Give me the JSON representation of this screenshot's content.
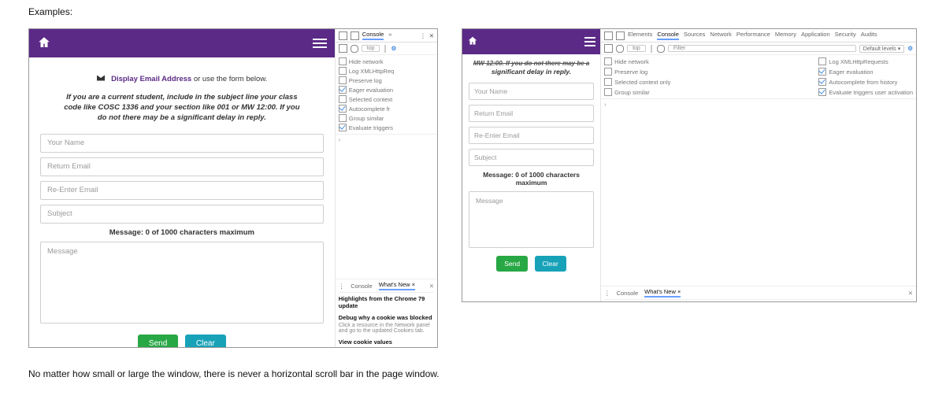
{
  "heading": "Examples:",
  "footnote": "No matter how small or large the window, there is never a horizontal scroll bar in the page window.",
  "ex1": {
    "form": {
      "cta_link": "Display Email Address",
      "cta_rest": " or use the form below.",
      "instructions": "If you are a current student, include in the subject line your class code like COSC 1336 and your section like 001 or MW 12:00. If you do not there may be a significant delay in reply.",
      "fields": [
        "Your Name",
        "Return Email",
        "Re-Enter Email",
        "Subject"
      ],
      "message_counter": "Message: 0 of 1000 characters maximum",
      "message_placeholder": "Message",
      "buttons": {
        "send": "Send",
        "clear": "Clear"
      }
    },
    "dev": {
      "tabs": [
        "Console",
        "»"
      ],
      "context": "top",
      "opts": [
        {
          "label": "Hide network",
          "checked": false
        },
        {
          "label": "Log XMLHttpReq",
          "checked": false
        },
        {
          "label": "Preserve log",
          "checked": false
        },
        {
          "label": "Eager evaluation",
          "checked": true
        },
        {
          "label": "Selected context",
          "checked": false
        },
        {
          "label": "Autocomplete fr",
          "checked": true
        },
        {
          "label": "Group similar",
          "checked": false
        },
        {
          "label": "Evaluate triggers",
          "checked": true
        }
      ],
      "drawer": {
        "tabs": [
          "Console",
          "What's New ×"
        ],
        "headline": "Highlights from the Chrome 79 update",
        "items": [
          {
            "title": "Debug why a cookie was blocked",
            "sub": "Click a resource in the Network panel and go to the updated Cookies tab."
          },
          {
            "title": "View cookie values",
            "sub": ""
          }
        ]
      }
    }
  },
  "ex2": {
    "form": {
      "instr_cut": "MW 12:00. If you do not there may be a",
      "instr_rest": "significant delay in reply.",
      "fields": [
        "Your Name",
        "Return Email",
        "Re-Enter Email",
        "Subject"
      ],
      "message_counter": "Message: 0 of 1000 characters maximum",
      "message_placeholder": "Message",
      "buttons": {
        "send": "Send",
        "clear": "Clear"
      }
    },
    "dev": {
      "tabs": [
        "Elements",
        "Console",
        "Sources",
        "Network",
        "Performance",
        "Memory",
        "Application",
        "Security",
        "Audits"
      ],
      "context": "top",
      "filter_placeholder": "Filter",
      "levels": "Default levels ▾",
      "left_opts": [
        "Hide network",
        "Preserve log",
        "Selected context only",
        "Group similar"
      ],
      "right_opts": [
        "Log XMLHttpRequests",
        "Eager evaluation",
        "Autocomplete from history",
        "Evaluate triggers user activation"
      ],
      "drawer": {
        "tabs": [
          "Console",
          "What's New ×"
        ]
      }
    }
  }
}
